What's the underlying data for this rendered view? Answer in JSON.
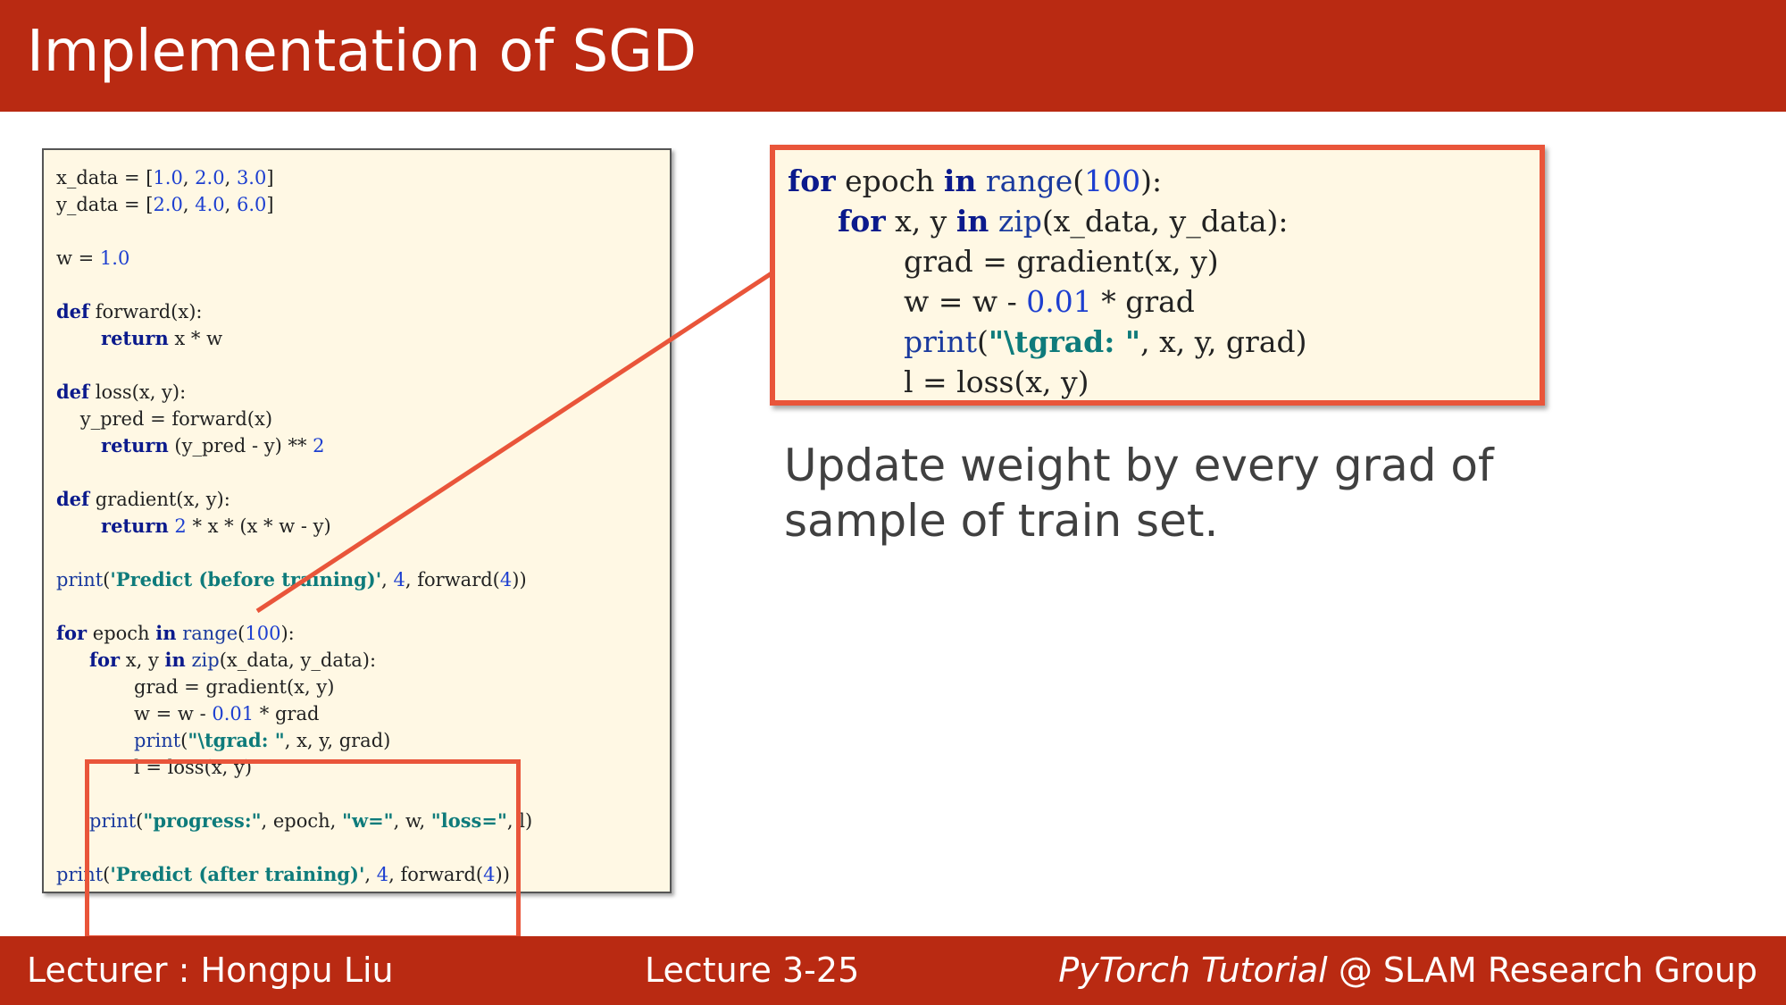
{
  "header": {
    "title": "Implementation of SGD"
  },
  "code": {
    "x_data_lhs": "x_data = [",
    "x_data_v1": "1.0",
    "x_data_v2": "2.0",
    "x_data_v3": "3.0",
    "y_data_lhs": "y_data = [",
    "y_data_v1": "2.0",
    "y_data_v2": "4.0",
    "y_data_v3": "6.0",
    "comma": ", ",
    "rbracket": "]",
    "w_lhs": "w = ",
    "w_val": "1.0",
    "kw_def": "def",
    "kw_return": "return",
    "kw_for": "for",
    "kw_in": "in",
    "forward_sig": " forward(x):",
    "forward_body": " x * w",
    "loss_sig": " loss(x, y):",
    "loss_ypred": "    y_pred = forward(x)",
    "loss_body": " (y_pred - y) ** ",
    "loss_pow": "2",
    "gradient_sig": " gradient(x, y):",
    "grad_num": "2",
    "grad_body": " * x * (x * w - y)",
    "print": "print",
    "lparen": "(",
    "rparen": ")",
    "predict_before": "'Predict (before training)'",
    "num4": "4",
    "forward4_head": ", forward(",
    "rparen2": "))",
    "epoch_mid": " epoch ",
    "range": "range",
    "hundred": "100",
    "range_close": "):",
    "loop_vars": " x, y ",
    "zip": "zip",
    "zip_args": "(x_data, y_data):",
    "grad_line": "grad = gradient(x, y)",
    "update_head": "w = w - ",
    "lr": "0.01",
    "update_tail": " * grad",
    "tgrad_str": "\"\\tgrad: \"",
    "print_grad_tail": ", x, y, grad)",
    "loss_line": "l = loss(x, y)",
    "progress_str": "\"progress:\"",
    "progress_mid1": ", epoch, ",
    "w_str": "\"w=\"",
    "progress_mid2": ", w, ",
    "loss_str": "\"loss=\"",
    "progress_tail": ", l)",
    "predict_after": "'Predict (after training)'"
  },
  "caption": {
    "line1": "Update weight by every grad of",
    "line2": "sample of train set."
  },
  "footer": {
    "lecturer": "Lecturer : Hongpu Liu",
    "lecture": "Lecture 3-25",
    "course": "PyTorch Tutorial",
    "group": " @ SLAM Research Group"
  },
  "colors": {
    "banner": "#b92a12",
    "highlight": "#e9553a",
    "code_bg": "#fff8e4",
    "keyword": "#0b1a8c",
    "number": "#1d3fd0",
    "string": "#0e7b7b"
  }
}
